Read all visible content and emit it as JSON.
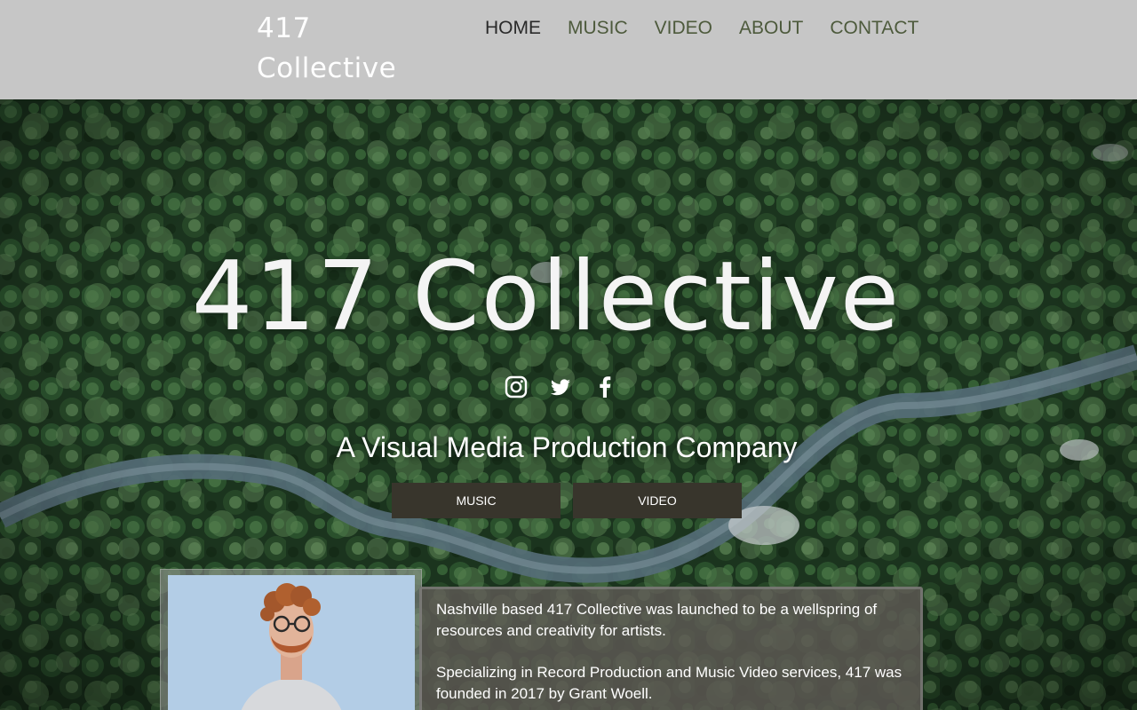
{
  "header": {
    "logo_text": "417 Collective",
    "nav": [
      {
        "label": "HOME",
        "active": true
      },
      {
        "label": "MUSIC",
        "active": false
      },
      {
        "label": "VIDEO",
        "active": false
      },
      {
        "label": "ABOUT",
        "active": false
      },
      {
        "label": "CONTACT",
        "active": false
      }
    ]
  },
  "hero": {
    "title": "417 Collective",
    "socials": [
      {
        "icon": "instagram-icon"
      },
      {
        "icon": "twitter-icon"
      },
      {
        "icon": "facebook-icon"
      }
    ],
    "tagline": "A Visual Media Production Company",
    "buttons": {
      "music": "MUSIC",
      "video": "VIDEO"
    }
  },
  "about": {
    "paragraphs": [
      "Nashville based 417 Collective was launched to be a wellspring of resources and creativity for artists.",
      "Specializing in Record Production and Music Video services, 417 was founded in 2017 by Grant Woell."
    ]
  },
  "colors": {
    "header_bg": "#c6c6c6",
    "nav_text": "#4d5a3c",
    "nav_active": "#2a2a2a",
    "button_bg": "#38352c"
  }
}
